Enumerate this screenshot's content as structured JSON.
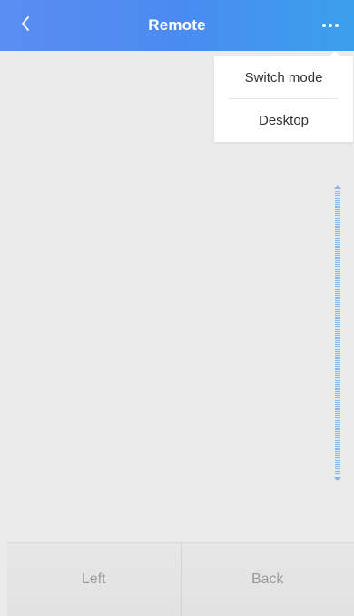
{
  "header": {
    "title": "Remote",
    "back_icon": "chevron-left-icon",
    "more_icon": "more-horizontal-icon"
  },
  "menu": {
    "items": [
      {
        "label": "Switch mode"
      },
      {
        "label": "Desktop"
      }
    ]
  },
  "scrollbar": {
    "up_icon": "arrow-up-icon",
    "down_icon": "arrow-down-icon"
  },
  "controls": {
    "left_label": "Left",
    "back_label": "Back"
  },
  "colors": {
    "header_start": "#5b8df2",
    "header_end": "#3aa0ec",
    "background": "#ebebeb",
    "scrollbar": "#8fb8ec"
  }
}
